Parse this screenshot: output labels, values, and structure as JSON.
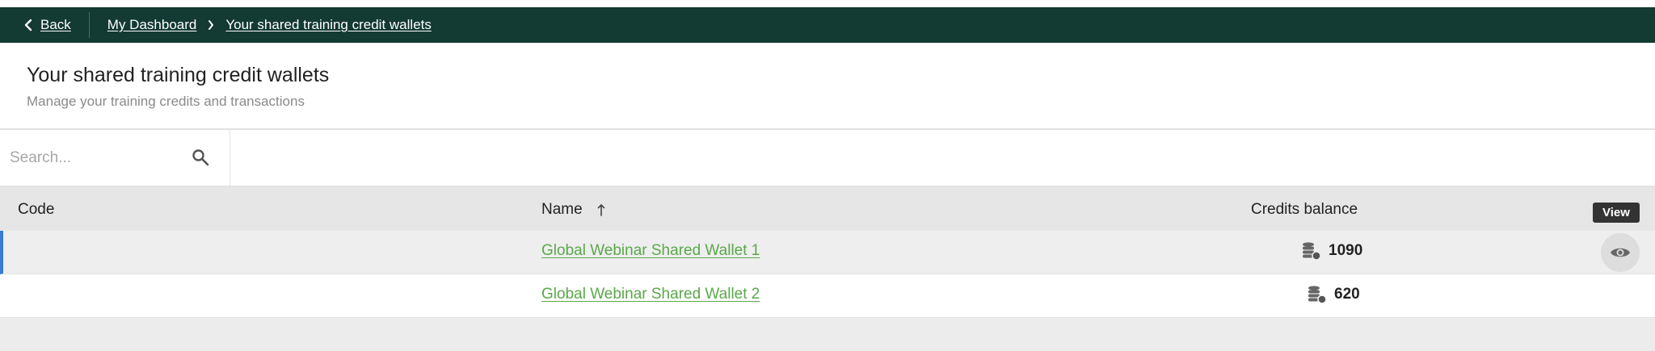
{
  "breadcrumb": {
    "back_label": "Back",
    "items": [
      "My Dashboard",
      "Your shared training credit wallets"
    ]
  },
  "header": {
    "title": "Your shared training credit wallets",
    "subtitle": "Manage your training credits and transactions"
  },
  "search": {
    "placeholder": "Search..."
  },
  "table": {
    "columns": {
      "code": "Code",
      "name": "Name",
      "credits": "Credits balance"
    },
    "sort": {
      "column": "Name",
      "direction": "ascending"
    },
    "rows": [
      {
        "code": "",
        "name": "Global Webinar Shared Wallet 1",
        "credits": "1090"
      },
      {
        "code": "",
        "name": "Global Webinar Shared Wallet 2",
        "credits": "620"
      }
    ],
    "view_tooltip": "View"
  },
  "colors": {
    "breadcrumb_bg": "#133a33",
    "link_green": "#5aa84a",
    "selected_row_accent": "#3a7bd5"
  },
  "icons": [
    "chevron-left-icon",
    "chevron-right-icon",
    "search-icon",
    "sort-arrow-up-icon",
    "coins-icon",
    "eye-icon"
  ]
}
